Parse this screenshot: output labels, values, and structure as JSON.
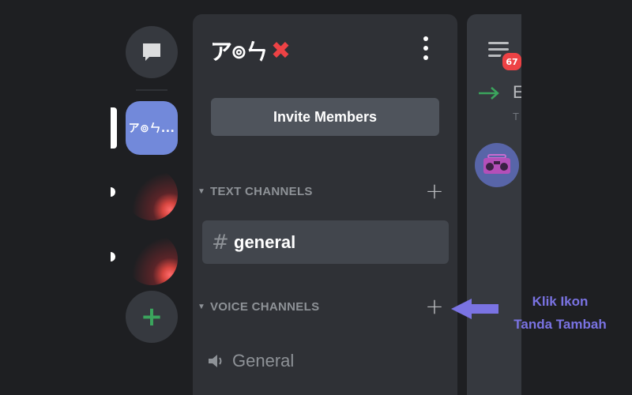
{
  "server_rail": {
    "active_server_abbrev": "ア⊚ㄣ...",
    "add_server_symbol": "+",
    "icons": [
      "chat-bubble-icon",
      "plus-icon"
    ]
  },
  "server": {
    "name": "ア⊚ㄣ",
    "name_mark": "✖",
    "invite_button": "Invite Members"
  },
  "categories": [
    {
      "label": "TEXT CHANNELS",
      "add_symbol": "+"
    },
    {
      "label": "VOICE CHANNELS",
      "add_symbol": "+"
    }
  ],
  "channels": {
    "text": [
      {
        "prefix": "#",
        "name": "general",
        "selected": true
      }
    ],
    "voice": [
      {
        "name": "General"
      }
    ]
  },
  "chat_panel": {
    "notification_count": "67",
    "partial_title": "E",
    "partial_subtitle": "T"
  },
  "annotation": {
    "line1": "Klik Ikon",
    "line2": "Tanda Tambah",
    "color": "#7a73e3"
  },
  "colors": {
    "background": "#1e1f22",
    "panel": "#2f3136",
    "blurple": "#7289da",
    "green": "#3ba55d",
    "red": "#ed4245"
  }
}
